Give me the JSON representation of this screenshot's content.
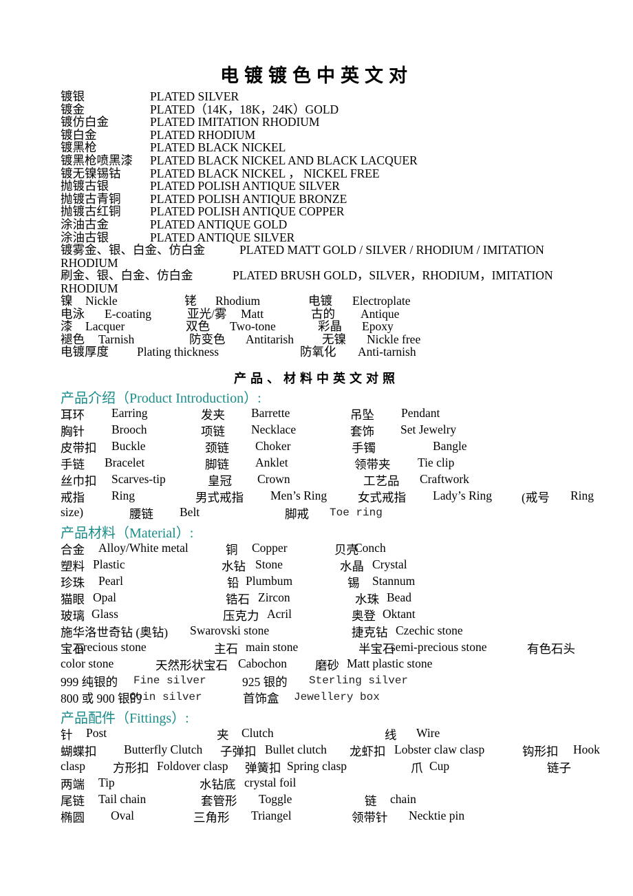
{
  "title": "电镀镀色中英文对",
  "plating": {
    "rows": [
      {
        "cn": "镀银",
        "en": "PLATED SILVER"
      },
      {
        "cn": "镀金",
        "en": "PLATED（14K，18K，24K）GOLD"
      },
      {
        "cn": "镀仿白金",
        "en": "PLATED IMITATION RHODIUM"
      },
      {
        "cn": "镀白金",
        "en": "PLATED RHODIUM"
      },
      {
        "cn": "镀黑枪",
        "en": "PLATED BLACK NICKEL"
      },
      {
        "cn": "镀黑枪喷黑漆",
        "en": "PLATED BLACK NICKEL AND BLACK LACQUER"
      },
      {
        "cn": "镀无镍锡钴",
        "en": "PLATED BLACK NICKEL ， NICKEL FREE"
      },
      {
        "cn": "抛镀古银",
        "en": "PLATED POLISH ANTIQUE SILVER"
      },
      {
        "cn": "抛镀古青铜",
        "en": "PLATED POLISH ANTIQUE BRONZE"
      },
      {
        "cn": "抛镀古红铜",
        "en": "PLATED POLISH ANTIQUE COPPER"
      },
      {
        "cn": "涂油古金",
        "en": "PLATED ANTIQUE GOLD"
      },
      {
        "cn": "涂油古银",
        "en": "PLATED ANTIQUE SILVER"
      }
    ],
    "long_rows": [
      {
        "cn": "镀雾金、银、白金、仿白金",
        "en": "PLATED MATT GOLD / SILVER / RHODIUM / IMITATION",
        "cont": "RHODIUM"
      },
      {
        "cn": "刷金、银、白金、仿白金",
        "en": "PLATED BRUSH GOLD，SILVER，RHODIUM，IMITATION",
        "cont": "RHODIUM"
      }
    ],
    "terms": [
      [
        {
          "cn": "镍",
          "en": "Nickle"
        },
        {
          "cn": "铑",
          "en": "Rhodium"
        },
        {
          "cn": "电镀",
          "en": "Electroplate"
        }
      ],
      [
        {
          "cn": "电泳",
          "en": "E-coating"
        },
        {
          "cn": "亚光/雾",
          "en": "Matt"
        },
        {
          "cn": "古的",
          "en": "Antique"
        }
      ],
      [
        {
          "cn": "漆",
          "en": "Lacquer"
        },
        {
          "cn": "双色",
          "en": "Two-tone"
        },
        {
          "cn": "彩晶",
          "en": "Epoxy"
        }
      ],
      [
        {
          "cn": "褪色",
          "en": "Tarnish"
        },
        {
          "cn": "防变色",
          "en": "Antitarish"
        },
        {
          "cn": "无镍",
          "en": "Nickle free"
        }
      ],
      [
        {
          "cn": "电镀厚度",
          "en": "Plating thickness"
        },
        {
          "cn": "防氧化",
          "en": "Anti-tarnish"
        }
      ]
    ]
  },
  "subtitle": "产品、材料中英文对照",
  "product_intro": {
    "heading": "产品介绍（Product Introduction）:",
    "rows": [
      [
        {
          "cn": "耳环",
          "en": "Earring"
        },
        {
          "cn": "发夹",
          "en": "Barrette"
        },
        {
          "cn": "吊坠",
          "en": "Pendant"
        }
      ],
      [
        {
          "cn": "胸针",
          "en": "Brooch"
        },
        {
          "cn": "项链",
          "en": "Necklace"
        },
        {
          "cn": "套饰",
          "en": "Set Jewelry"
        }
      ],
      [
        {
          "cn": "皮带扣",
          "en": "Buckle"
        },
        {
          "cn": "颈链",
          "en": "Choker"
        },
        {
          "cn": "手镯",
          "en": "Bangle"
        }
      ],
      [
        {
          "cn": "手链",
          "en": "Bracelet"
        },
        {
          "cn": "脚链",
          "en": "Anklet"
        },
        {
          "cn": "领带夹",
          "en": "Tie clip"
        }
      ],
      [
        {
          "cn": "丝巾扣",
          "en": "Scarves-tip"
        },
        {
          "cn": "皇冠",
          "en": "Crown"
        },
        {
          "cn": "工艺品",
          "en": "Craftwork"
        }
      ],
      [
        {
          "cn": "戒指",
          "en": "Ring"
        },
        {
          "cn": "男式戒指",
          "en": "Men’s Ring"
        },
        {
          "cn": "女式戒指",
          "en": "Lady’s Ring"
        },
        {
          "cn": "(戒号",
          "en": "Ring"
        }
      ],
      [
        {
          "cn": "",
          "en": "size)"
        },
        {
          "cn": "腰链",
          "en": "Belt"
        },
        {
          "cn": "脚戒",
          "en": "Toe ring"
        }
      ]
    ]
  },
  "material": {
    "heading": "产品材料（Material）:",
    "rows": [
      [
        {
          "cn": "合金",
          "en": "Alloy/White metal"
        },
        {
          "cn": "铜",
          "en": "Copper"
        },
        {
          "cn": "贝壳",
          "en": "Conch"
        }
      ],
      [
        {
          "cn": "塑料",
          "en": "Plastic"
        },
        {
          "cn": "水钻",
          "en": "Stone"
        },
        {
          "cn": "水晶",
          "en": "Crystal"
        }
      ],
      [
        {
          "cn": "珍珠",
          "en": "Pearl"
        },
        {
          "cn": "铅",
          "en": "Plumbum"
        },
        {
          "cn": "锡",
          "en": "Stannum"
        }
      ],
      [
        {
          "cn": "猫眼",
          "en": "Opal"
        },
        {
          "cn": "锆石",
          "en": "Zircon"
        },
        {
          "cn": "水珠",
          "en": "Bead"
        }
      ],
      [
        {
          "cn": "玻璃",
          "en": "Glass"
        },
        {
          "cn": "压克力",
          "en": "Acril"
        },
        {
          "cn": "奥登",
          "en": "Oktant"
        }
      ],
      [
        {
          "cn": "施华洛世奇钻 (奥钻)",
          "en": "Swarovski stone"
        },
        {
          "cn": "捷克钻",
          "en": "Czechic stone"
        }
      ],
      [
        {
          "cn": "宝石",
          "en": "precious stone"
        },
        {
          "cn": "主石",
          "en": "main stone"
        },
        {
          "cn": "半宝石",
          "en": "semi-precious stone"
        },
        {
          "cn": "有色石头",
          "en": ""
        }
      ],
      [
        {
          "cn": "",
          "en": "color stone"
        },
        {
          "cn": "天然形状宝石",
          "en": "Cabochon"
        },
        {
          "cn": "磨砂",
          "en": "Matt plastic stone"
        }
      ],
      [
        {
          "cn": "999 纯银的",
          "en": "Fine silver"
        },
        {
          "cn": "925 银的",
          "en": "Sterling silver"
        }
      ],
      [
        {
          "cn": "800 或 900 银的",
          "en": "Coin silver"
        },
        {
          "cn": "首饰盒",
          "en": "Jewellery box"
        }
      ]
    ]
  },
  "fittings": {
    "heading": "产品配件（Fittings）:",
    "rows": [
      [
        {
          "cn": "针",
          "en": "Post"
        },
        {
          "cn": "夹",
          "en": "Clutch"
        },
        {
          "cn": "线",
          "en": "Wire"
        }
      ],
      [
        {
          "cn": "蝴蝶扣",
          "en": "Butterfly Clutch"
        },
        {
          "cn": "子弹扣",
          "en": "Bullet clutch"
        },
        {
          "cn": "龙虾扣",
          "en": "Lobster claw clasp"
        },
        {
          "cn": "钩形扣",
          "en": "Hook"
        }
      ],
      [
        {
          "cn": "",
          "en": "clasp"
        },
        {
          "cn": "方形扣",
          "en": "Foldover clasp"
        },
        {
          "cn": "弹簧扣",
          "en": "Spring clasp"
        },
        {
          "cn": "爪",
          "en": "Cup"
        },
        {
          "cn": "链子",
          "en": ""
        }
      ],
      [
        {
          "cn": "两端",
          "en": "Tip"
        },
        {
          "cn": "水钻底",
          "en": "crystal foil"
        }
      ],
      [
        {
          "cn": "尾链",
          "en": "Tail chain"
        },
        {
          "cn": "套管形",
          "en": "Toggle"
        },
        {
          "cn": "链",
          "en": "chain"
        }
      ],
      [
        {
          "cn": "椭圆",
          "en": "Oval"
        },
        {
          "cn": "三角形",
          "en": "Triangel"
        },
        {
          "cn": "领带针",
          "en": "Necktie pin"
        }
      ]
    ]
  }
}
